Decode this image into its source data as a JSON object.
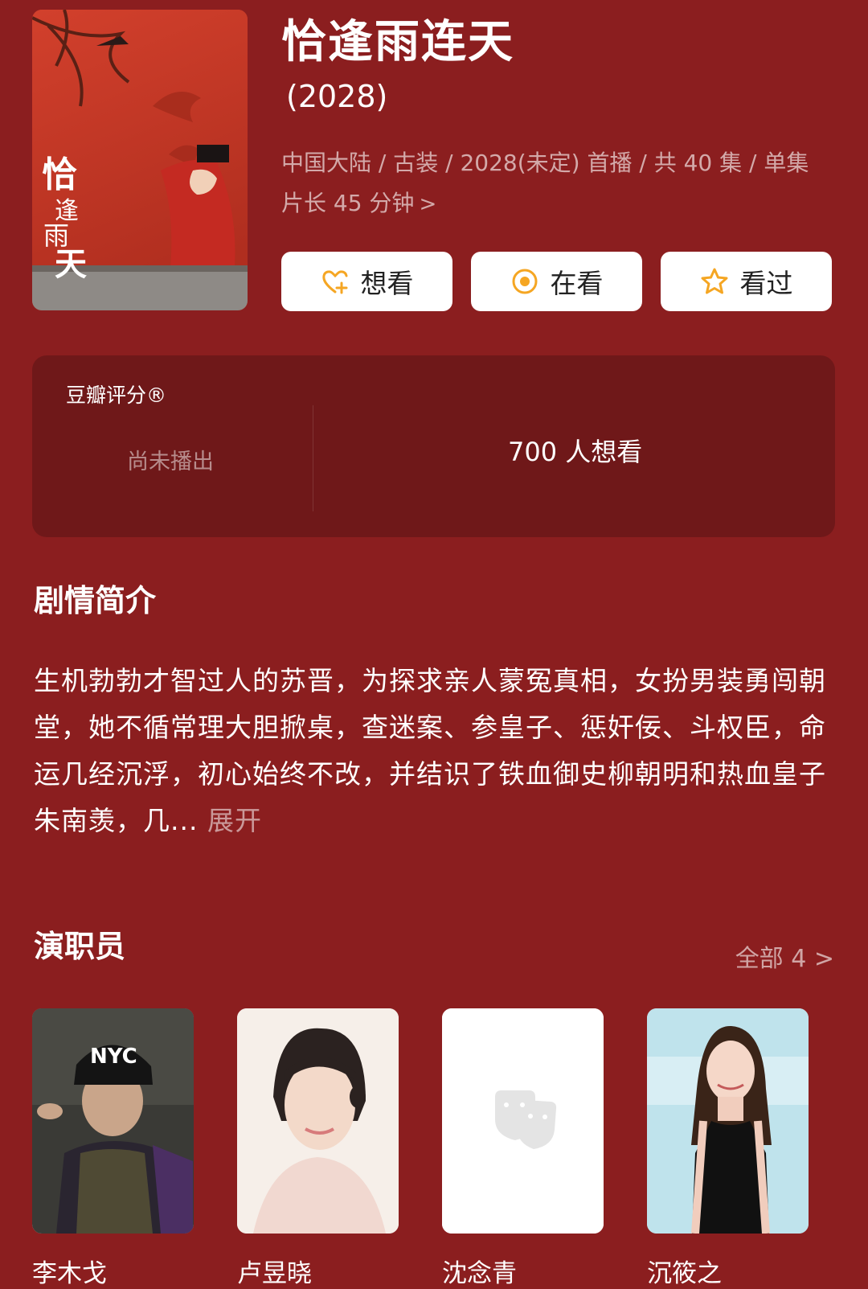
{
  "title": "恰逢雨连天",
  "year": "(2028)",
  "meta_line1": "中国大陆 / 古装 / 2028(未定) 首播 / 共 40 集 / 单集",
  "meta_line2": "片长 45 分钟",
  "actions": {
    "want": "想看",
    "watching": "在看",
    "watched": "看过"
  },
  "rating": {
    "label": "豆瓣评分®",
    "status": "尚未播出",
    "want_count": "700 人想看"
  },
  "synopsis": {
    "heading": "剧情简介",
    "text": "生机勃勃才智过人的苏晋，为探求亲人蒙冤真相，女扮男装勇闯朝堂，她不循常理大胆掀桌，查迷案、参皇子、惩奸佞、斗权臣，命运几经沉浮，初心始终不改，并结识了铁血御史柳朝明和热血皇子朱南羡，几...",
    "expand": "展开"
  },
  "cast": {
    "heading": "演职员",
    "all_label": "全部 4",
    "members": [
      {
        "name": "李木戈"
      },
      {
        "name": "卢昱晓"
      },
      {
        "name": "沈念青"
      },
      {
        "name": "沉筱之"
      }
    ]
  },
  "poster_text": "恰逢雨连天",
  "colors": {
    "background": "#8b1e1f",
    "rating_card": "#6f1819",
    "action_icon": "#f5a623"
  }
}
